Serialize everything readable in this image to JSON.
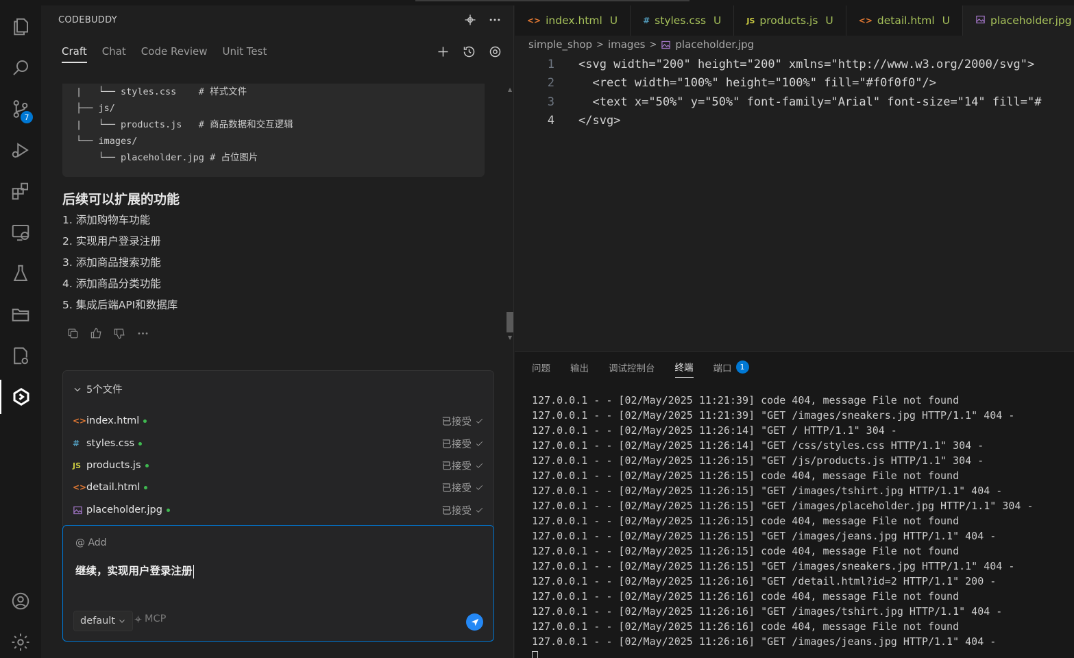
{
  "sidebar_title": "CODEBUDDY",
  "source_control_badge": "7",
  "tabs": [
    "Craft",
    "Chat",
    "Code Review",
    "Unit Test"
  ],
  "tree_lines": [
    "|   └── styles.css    # 样式文件",
    "├── js/",
    "|   └── products.js   # 商品数据和交互逻辑",
    "└── images/",
    "    └── placeholder.jpg # 占位图片"
  ],
  "section_heading": "后续可以扩展的功能",
  "feature_list": [
    "1. 添加购物车功能",
    "2. 实现用户登录注册",
    "3. 添加商品搜索功能",
    "4. 添加商品分类功能",
    "5. 集成后端API和数据库"
  ],
  "files_panel": {
    "title": "5个文件",
    "files": [
      {
        "name": "index.html",
        "icon": "<>",
        "status": "已接受"
      },
      {
        "name": "styles.css",
        "icon": "#",
        "status": "已接受"
      },
      {
        "name": "products.js",
        "icon": "JS",
        "status": "已接受"
      },
      {
        "name": "detail.html",
        "icon": "<>",
        "status": "已接受"
      },
      {
        "name": "placeholder.jpg",
        "icon": "img",
        "status": "已接受"
      }
    ]
  },
  "input": {
    "add_label": "@ Add",
    "text": "继续，实现用户登录注册",
    "model": "default",
    "mcp_label": "MCP"
  },
  "editor_tabs": [
    {
      "name": "index.html",
      "icon": "<>",
      "status": "U"
    },
    {
      "name": "styles.css",
      "icon": "#",
      "status": "U"
    },
    {
      "name": "products.js",
      "icon": "JS",
      "status": "U"
    },
    {
      "name": "detail.html",
      "icon": "<>",
      "status": "U"
    },
    {
      "name": "placeholder.jpg",
      "icon": "img",
      "status": ""
    }
  ],
  "breadcrumb": [
    "simple_shop",
    "images",
    "placeholder.jpg"
  ],
  "code_lines": [
    {
      "num": "1",
      "text": "<svg width=\"200\" height=\"200\" xmlns=\"http://www.w3.org/2000/svg\">"
    },
    {
      "num": "2",
      "text": "  <rect width=\"100%\" height=\"100%\" fill=\"#f0f0f0\"/>"
    },
    {
      "num": "3",
      "text": "  <text x=\"50%\" y=\"50%\" font-family=\"Arial\" font-size=\"14\" fill=\"#"
    },
    {
      "num": "4",
      "text": "</svg>"
    }
  ],
  "panel_tabs": [
    {
      "label": "问题"
    },
    {
      "label": "输出"
    },
    {
      "label": "调试控制台"
    },
    {
      "label": "终端",
      "active": true
    },
    {
      "label": "端口",
      "badge": "1"
    }
  ],
  "terminal_lines": [
    "127.0.0.1 - - [02/May/2025 11:21:39] code 404, message File not found",
    "127.0.0.1 - - [02/May/2025 11:21:39] \"GET /images/sneakers.jpg HTTP/1.1\" 404 -",
    "127.0.0.1 - - [02/May/2025 11:26:14] \"GET / HTTP/1.1\" 304 -",
    "127.0.0.1 - - [02/May/2025 11:26:14] \"GET /css/styles.css HTTP/1.1\" 304 -",
    "127.0.0.1 - - [02/May/2025 11:26:15] \"GET /js/products.js HTTP/1.1\" 304 -",
    "127.0.0.1 - - [02/May/2025 11:26:15] code 404, message File not found",
    "127.0.0.1 - - [02/May/2025 11:26:15] \"GET /images/tshirt.jpg HTTP/1.1\" 404 -",
    "127.0.0.1 - - [02/May/2025 11:26:15] \"GET /images/placeholder.jpg HTTP/1.1\" 304 -",
    "127.0.0.1 - - [02/May/2025 11:26:15] code 404, message File not found",
    "127.0.0.1 - - [02/May/2025 11:26:15] \"GET /images/jeans.jpg HTTP/1.1\" 404 -",
    "127.0.0.1 - - [02/May/2025 11:26:15] code 404, message File not found",
    "127.0.0.1 - - [02/May/2025 11:26:15] \"GET /images/sneakers.jpg HTTP/1.1\" 404 -",
    "127.0.0.1 - - [02/May/2025 11:26:16] \"GET /detail.html?id=2 HTTP/1.1\" 200 -",
    "127.0.0.1 - - [02/May/2025 11:26:16] code 404, message File not found",
    "127.0.0.1 - - [02/May/2025 11:26:16] \"GET /images/tshirt.jpg HTTP/1.1\" 404 -",
    "127.0.0.1 - - [02/May/2025 11:26:16] code 404, message File not found",
    "127.0.0.1 - - [02/May/2025 11:26:16] \"GET /images/jeans.jpg HTTP/1.1\" 404 -"
  ],
  "colors": {
    "accent": "#0078d4",
    "untracked": "#a6c15a",
    "string": "#ce9178",
    "send_button": "#2488f5"
  }
}
